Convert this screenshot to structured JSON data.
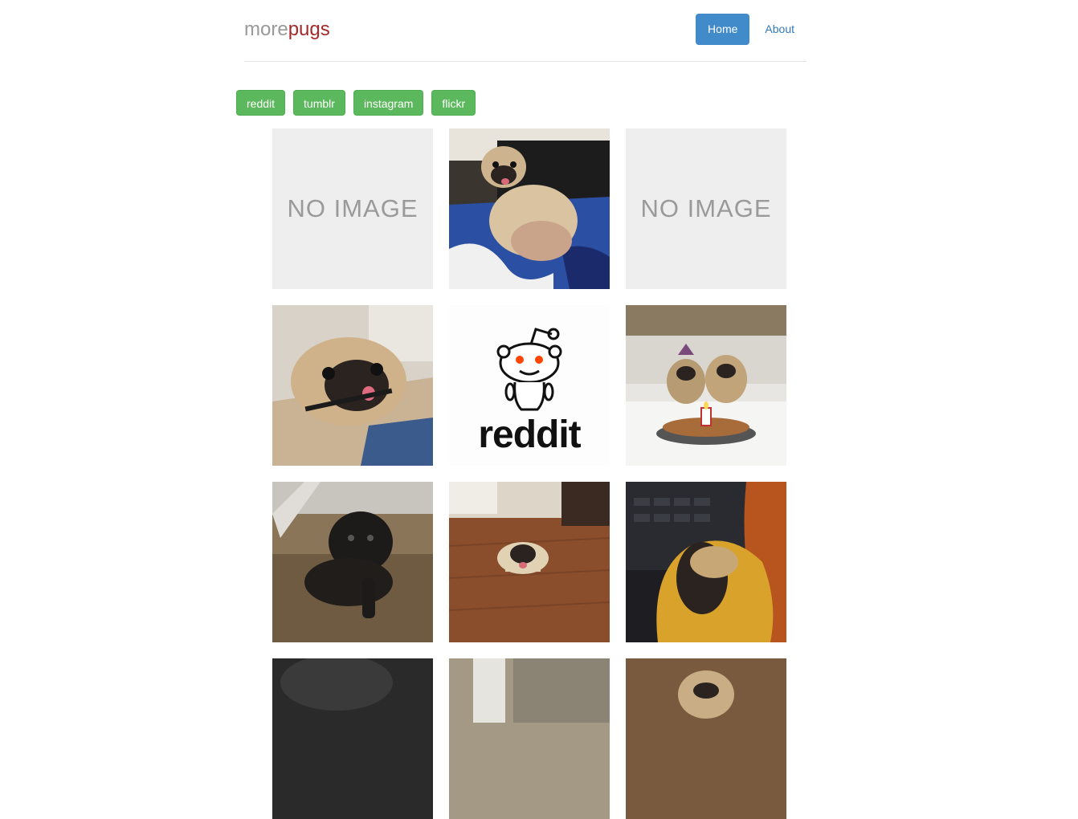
{
  "brand": {
    "part1": "more",
    "part2": "pugs"
  },
  "nav": {
    "home": "Home",
    "about": "About"
  },
  "sources": [
    "reddit",
    "tumblr",
    "instagram",
    "flickr"
  ],
  "tiles": [
    {
      "kind": "placeholder",
      "text": "NO IMAGE"
    },
    {
      "kind": "photo",
      "subject": "pug lounging on couch with belly up"
    },
    {
      "kind": "placeholder",
      "text": "NO IMAGE"
    },
    {
      "kind": "photo",
      "subject": "pug face close-up tongue out"
    },
    {
      "kind": "logo",
      "text": "reddit"
    },
    {
      "kind": "photo",
      "subject": "two pugs with birthday cake"
    },
    {
      "kind": "photo",
      "subject": "black pug on corduroy couch"
    },
    {
      "kind": "photo",
      "subject": "pug lying on wooden floor"
    },
    {
      "kind": "photo",
      "subject": "pug in yellow blanket near laptop"
    },
    {
      "kind": "photo",
      "subject": "dark pug close-up"
    },
    {
      "kind": "photo",
      "subject": "pug by window"
    },
    {
      "kind": "photo",
      "subject": "pug peeking"
    }
  ],
  "colors": {
    "brand_grey": "#999999",
    "brand_red": "#a52a2a",
    "nav_active": "#428bca",
    "source_green": "#5cb85c"
  }
}
